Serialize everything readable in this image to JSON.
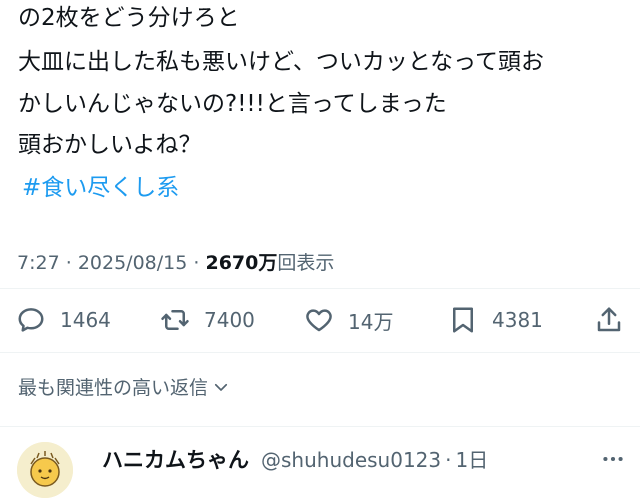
{
  "tweet": {
    "lines": [
      "の2枚をどう分けろと",
      "大皿に出した私も悪いけど、ついカッとなって頭お",
      "かしいんじゃないの?!!!と言ってしまった",
      "頭おかしいよね？"
    ],
    "hashtag": "#食い尽くし系",
    "time": "7:27",
    "dot1": "·",
    "date": "2025/08/15",
    "dot2": "·",
    "views_count": "2670",
    "views_unit": "万",
    "views_label": "回表示"
  },
  "actions": {
    "reply_count": "1464",
    "retweet_count": "7400",
    "like_count": "14万",
    "bookmark_count": "4381"
  },
  "replies": {
    "sort_label": "最も関連性の高い返信"
  },
  "reply_item": {
    "name": "ハニカムちゃん",
    "handle": "@shuhudesu0123",
    "dot": "·",
    "time": "1日"
  },
  "icons": {
    "reply": "speech-bubble-icon",
    "retweet": "retweet-icon",
    "like": "heart-icon",
    "bookmark": "bookmark-icon",
    "share": "share-icon",
    "sort": "chevron-down-icon",
    "more": "more-dots-icon"
  },
  "colors": {
    "text": "#0f1419",
    "secondary": "#536471",
    "link": "#1d9bf0",
    "divider": "#eff3f4"
  }
}
